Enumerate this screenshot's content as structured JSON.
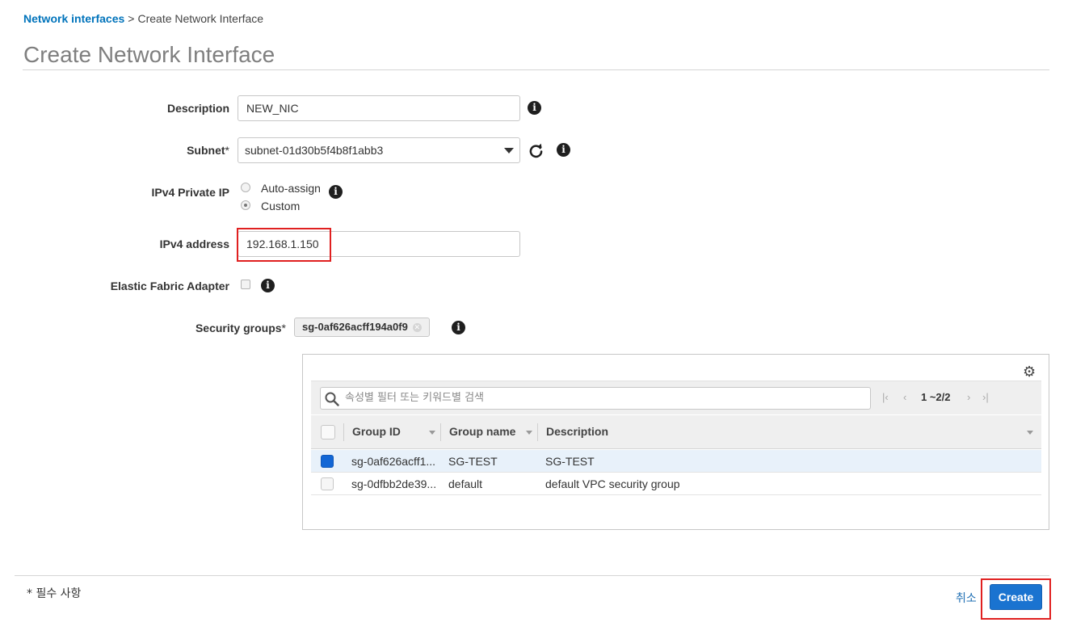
{
  "breadcrumb": {
    "parent": "Network interfaces",
    "separator": ">",
    "current": "Create Network Interface"
  },
  "page": {
    "title": "Create Network Interface"
  },
  "form": {
    "description": {
      "label": "Description",
      "value": "NEW_NIC"
    },
    "subnet": {
      "label": "Subnet",
      "required_mark": "*",
      "value": "subnet-01d30b5f4b8f1abb3"
    },
    "ipv4_private_ip": {
      "label": "IPv4 Private IP",
      "options": [
        "Auto-assign",
        "Custom"
      ],
      "selected": "Custom"
    },
    "ipv4_address": {
      "label": "IPv4 address",
      "value": "192.168.1.150"
    },
    "efa": {
      "label": "Elastic Fabric Adapter",
      "checked": false
    },
    "security_groups": {
      "label": "Security groups",
      "required_mark": "*",
      "token": "sg-0af626acff194a0f9"
    }
  },
  "sg_table": {
    "filter_placeholder": "속성별 필터 또는 키워드별 검색",
    "pager_text": "1 ~2/2",
    "columns": [
      "Group ID",
      "Group name",
      "Description"
    ],
    "rows": [
      {
        "group_id": "sg-0af626acff1...",
        "group_name": "SG-TEST",
        "description": "SG-TEST",
        "selected": true
      },
      {
        "group_id": "sg-0dfbb2de39...",
        "group_name": "default",
        "description": "default VPC security group",
        "selected": false
      }
    ]
  },
  "footer": {
    "required_note": "* 필수 사항",
    "cancel_label": "취소",
    "create_label": "Create"
  },
  "colors": {
    "link": "#0073bb",
    "primary_button": "#1a73d0",
    "highlight_box": "#e02020",
    "selected_row": "#e8f1fa"
  }
}
